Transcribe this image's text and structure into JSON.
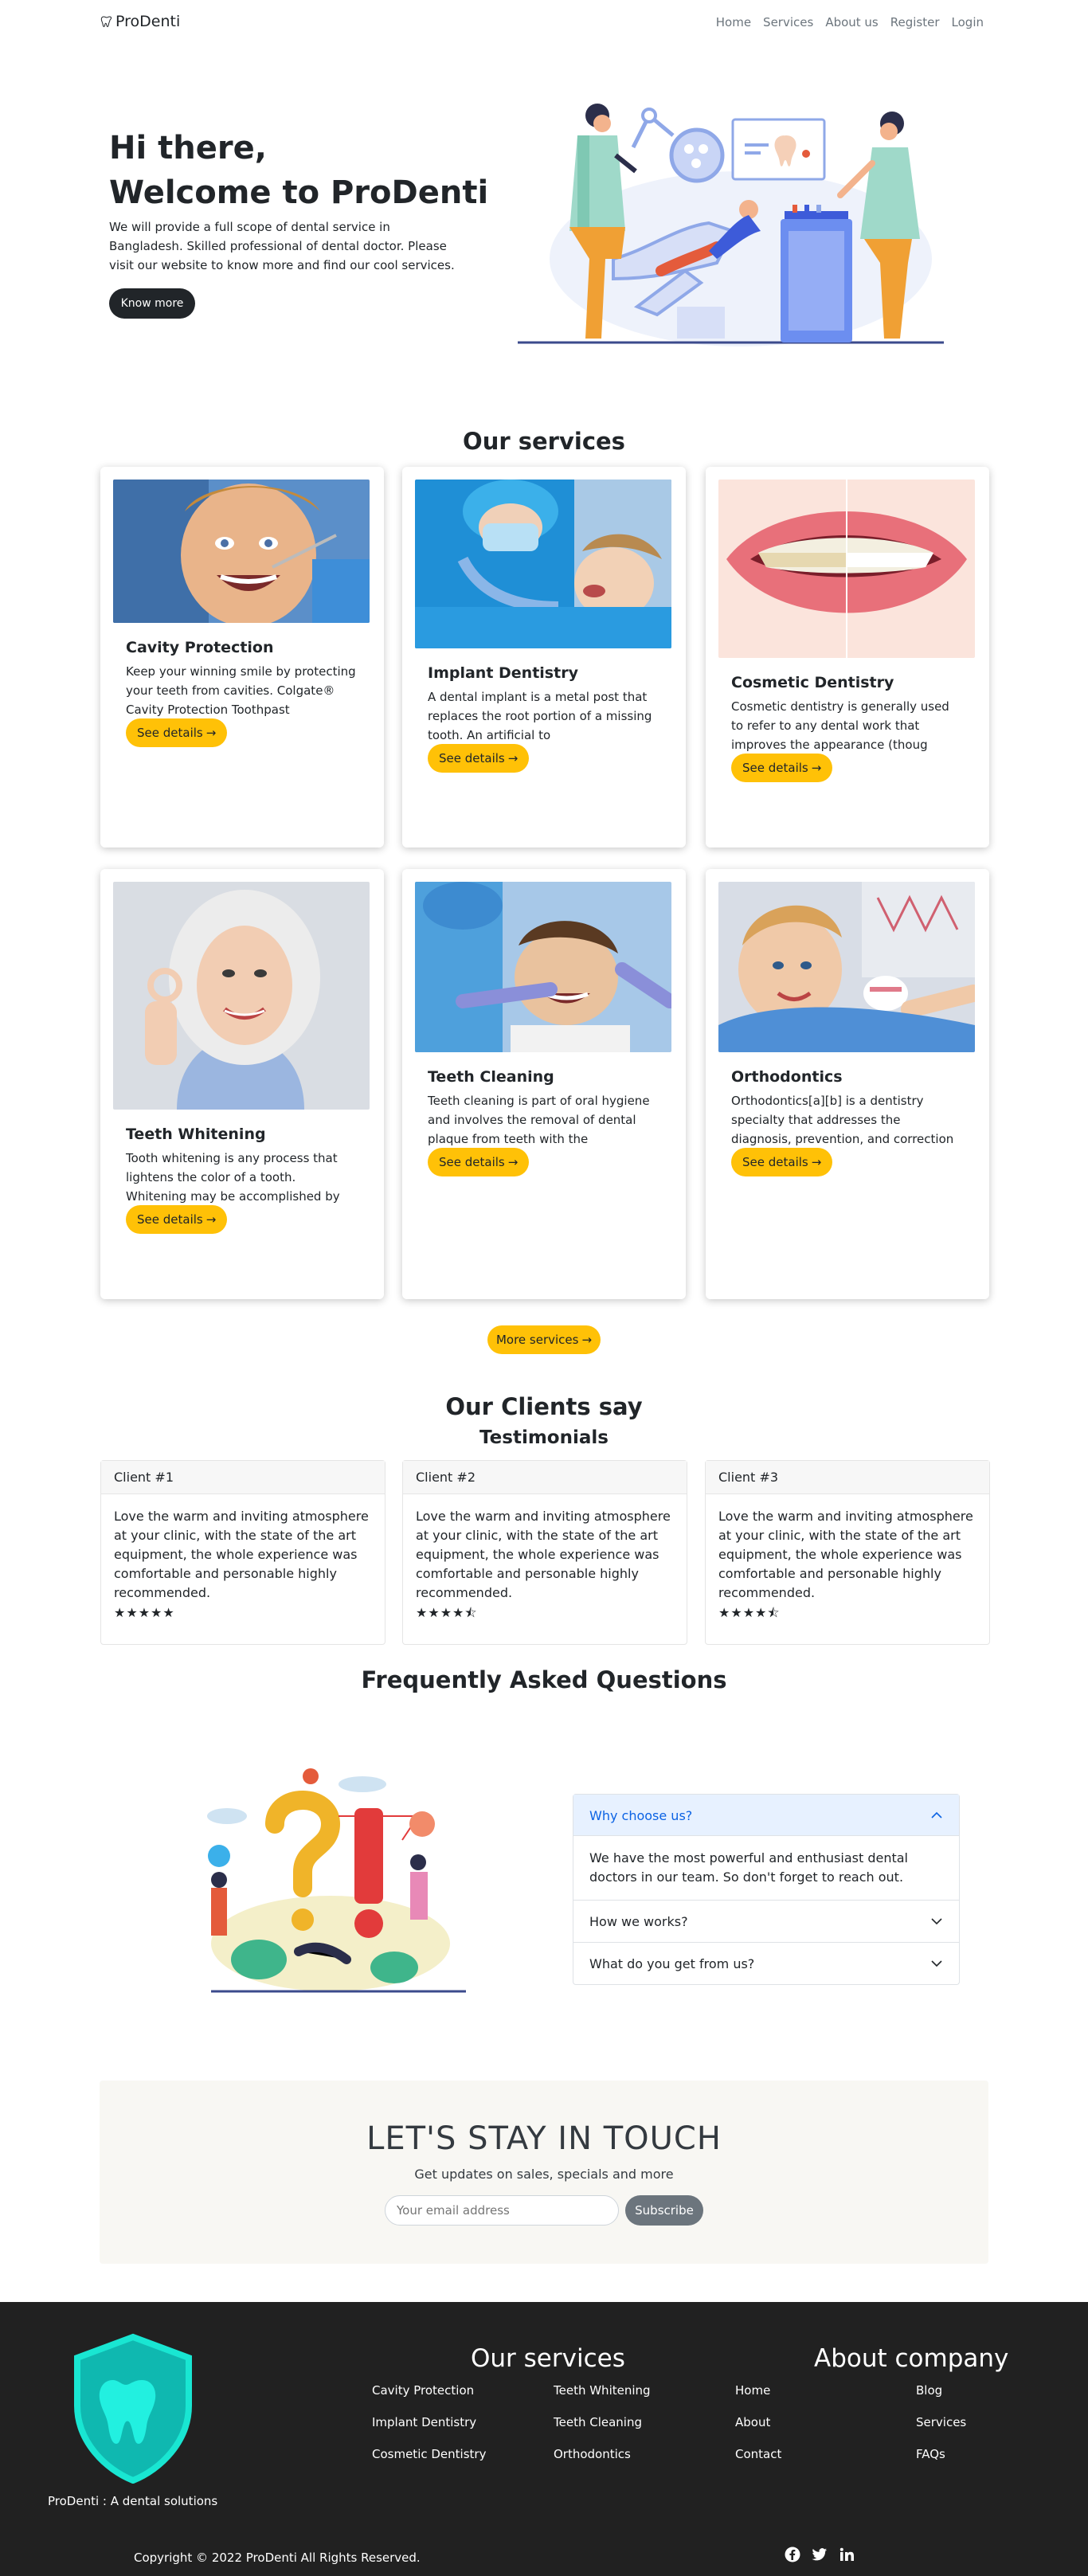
{
  "nav": {
    "brand": "ProDenti",
    "links": [
      "Home",
      "Services",
      "About us",
      "Register",
      "Login"
    ]
  },
  "hero": {
    "title_line1": "Hi there,",
    "title_line2": "Welcome to ProDenti",
    "text": "We will provide a full scope of dental service in Bangladesh. Skilled professional of dental doctor. Please visit our website to know more and find our cool services.",
    "button": "Know more"
  },
  "services": {
    "title": "Our services",
    "details_label": "See details",
    "more_button": "More services",
    "cards": [
      {
        "title": "Cavity Protection",
        "text": "Keep your winning smile by protecting your teeth from cavities. Colgate® Cavity Protection Toothpast"
      },
      {
        "title": "Implant Dentistry",
        "text": "A dental implant is a metal post that replaces the root portion of a missing tooth. An artificial to"
      },
      {
        "title": "Cosmetic Dentistry",
        "text": "Cosmetic dentistry is generally used to refer to any dental work that improves the appearance (thoug"
      },
      {
        "title": "Teeth Whitening",
        "text": "Tooth whitening is any process that lightens the color of a tooth. Whitening may be accomplished by"
      },
      {
        "title": "Teeth Cleaning",
        "text": "Teeth cleaning is part of oral hygiene and involves the removal of dental plaque from teeth with the"
      },
      {
        "title": "Orthodontics",
        "text": "Orthodontics[a][b] is a dentistry specialty that addresses the diagnosis, prevention, and correction"
      }
    ]
  },
  "testimonials": {
    "title": "Our Clients say",
    "subtitle": "Testimonials",
    "items": [
      {
        "client": "Client #1",
        "text": "Love the warm and inviting atmosphere at your clinic, with the state of the art equipment, the whole experience was comfortable and personable highly recommended.",
        "rating": 5,
        "stars": "★★★★★"
      },
      {
        "client": "Client #2",
        "text": "Love the warm and inviting atmosphere at your clinic, with the state of the art equipment, the whole experience was comfortable and personable highly recommended.",
        "rating": 4.5,
        "stars": "★★★★⯪"
      },
      {
        "client": "Client #3",
        "text": "Love the warm and inviting atmosphere at your clinic, with the state of the art equipment, the whole experience was comfortable and personable highly recommended.",
        "rating": 4.5,
        "stars": "★★★★⯪"
      }
    ]
  },
  "faq": {
    "title": "Frequently Asked Questions",
    "items": [
      {
        "question": "Why choose us?",
        "answer": "We have the most powerful and enthusiast dental doctors in our team. So don't forget to reach out.",
        "open": true
      },
      {
        "question": "How we works?",
        "answer": "",
        "open": false
      },
      {
        "question": "What do you get from us?",
        "answer": "",
        "open": false
      }
    ]
  },
  "newsletter": {
    "title": "LET'S STAY IN TOUCH",
    "subtitle": "Get updates on sales, specials and more",
    "placeholder": "Your email address",
    "button": "Subscribe"
  },
  "footer": {
    "tagline": "ProDenti : A dental solutions",
    "services_title": "Our services",
    "services_col1": [
      "Cavity Protection",
      "Implant Dentistry",
      "Cosmetic Dentistry"
    ],
    "services_col2": [
      "Teeth Whitening",
      "Teeth Cleaning",
      "Orthodontics"
    ],
    "about_title": "About company",
    "about_col1": [
      "Home",
      "About",
      "Contact"
    ],
    "about_col2": [
      "Blog",
      "Services",
      "FAQs"
    ],
    "copyright": "Copyright © 2022 ProDenti All Rights Reserved.",
    "social_icons": [
      "facebook-icon",
      "twitter-icon",
      "linkedin-icon"
    ]
  },
  "colors": {
    "accent_yellow": "#ffc107",
    "dark": "#212529",
    "footer_bg": "#212121",
    "accordion_active_bg": "#e7f1ff",
    "accordion_active_text": "#0c63e4",
    "logo_teal": "#19e6d2"
  }
}
